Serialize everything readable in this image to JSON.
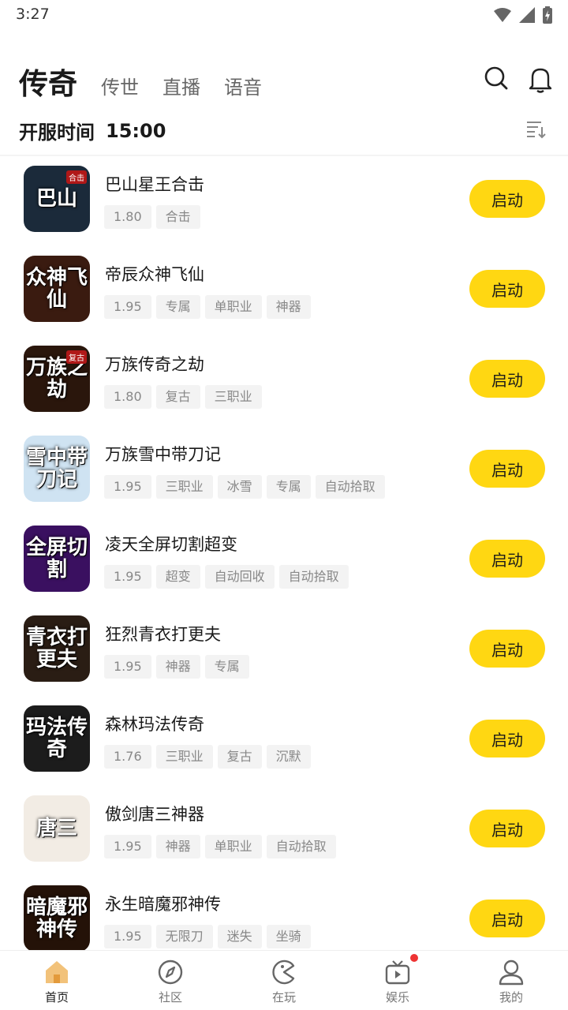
{
  "status_bar": {
    "time": "3:27"
  },
  "header": {
    "tabs": [
      {
        "label": "传奇",
        "active": true
      },
      {
        "label": "传世",
        "active": false
      },
      {
        "label": "直播",
        "active": false
      },
      {
        "label": "语音",
        "active": false
      }
    ],
    "icons": [
      "search-icon",
      "bell-icon"
    ]
  },
  "open_time": {
    "label": "开服时间",
    "value": "15:00"
  },
  "games": [
    {
      "title": "巴山星王合击",
      "icon_text": "巴山",
      "icon_tag": "合击",
      "tags": [
        "1.80",
        "合击"
      ],
      "button": "启动"
    },
    {
      "title": "帝辰众神飞仙",
      "icon_text": "众神飞仙",
      "icon_tag": "",
      "tags": [
        "1.95",
        "专属",
        "单职业",
        "神器"
      ],
      "button": "启动"
    },
    {
      "title": "万族传奇之劫",
      "icon_text": "万族之劫",
      "icon_tag": "复古",
      "tags": [
        "1.80",
        "复古",
        "三职业"
      ],
      "button": "启动"
    },
    {
      "title": "万族雪中带刀记",
      "icon_text": "雪中带刀记",
      "icon_tag": "",
      "tags": [
        "1.95",
        "三职业",
        "冰雪",
        "专属",
        "自动拾取"
      ],
      "button": "启动"
    },
    {
      "title": "凌天全屏切割超变",
      "icon_text": "全屏切割",
      "icon_tag": "",
      "tags": [
        "1.95",
        "超变",
        "自动回收",
        "自动拾取"
      ],
      "button": "启动"
    },
    {
      "title": "狂烈青衣打更夫",
      "icon_text": "青衣打更夫",
      "icon_tag": "",
      "tags": [
        "1.95",
        "神器",
        "专属"
      ],
      "button": "启动"
    },
    {
      "title": "森林玛法传奇",
      "icon_text": "玛法传奇",
      "icon_tag": "",
      "tags": [
        "1.76",
        "三职业",
        "复古",
        "沉默"
      ],
      "button": "启动"
    },
    {
      "title": "傲剑唐三神器",
      "icon_text": "唐三",
      "icon_tag": "",
      "tags": [
        "1.95",
        "神器",
        "单职业",
        "自动拾取"
      ],
      "button": "启动"
    },
    {
      "title": "永生暗魔邪神传",
      "icon_text": "暗魔邪神传",
      "icon_tag": "",
      "tags": [
        "1.95",
        "无限刀",
        "迷失",
        "坐骑"
      ],
      "button": "启动"
    }
  ],
  "icon_colors": [
    "#1b2a3a",
    "#3a1b10",
    "#2a160c",
    "#cfe3f2",
    "#3a1060",
    "#2a1d14",
    "#1c1c1c",
    "#f2ece4",
    "#241208"
  ],
  "accent_color": "#ffd712",
  "bottom_nav": [
    {
      "label": "首页",
      "icon": "home-icon",
      "active": true
    },
    {
      "label": "社区",
      "icon": "compass-icon",
      "active": false
    },
    {
      "label": "在玩",
      "icon": "gamepad-icon",
      "active": false
    },
    {
      "label": "娱乐",
      "icon": "tv-icon",
      "active": false,
      "badge": true
    },
    {
      "label": "我的",
      "icon": "user-icon",
      "active": false
    }
  ]
}
